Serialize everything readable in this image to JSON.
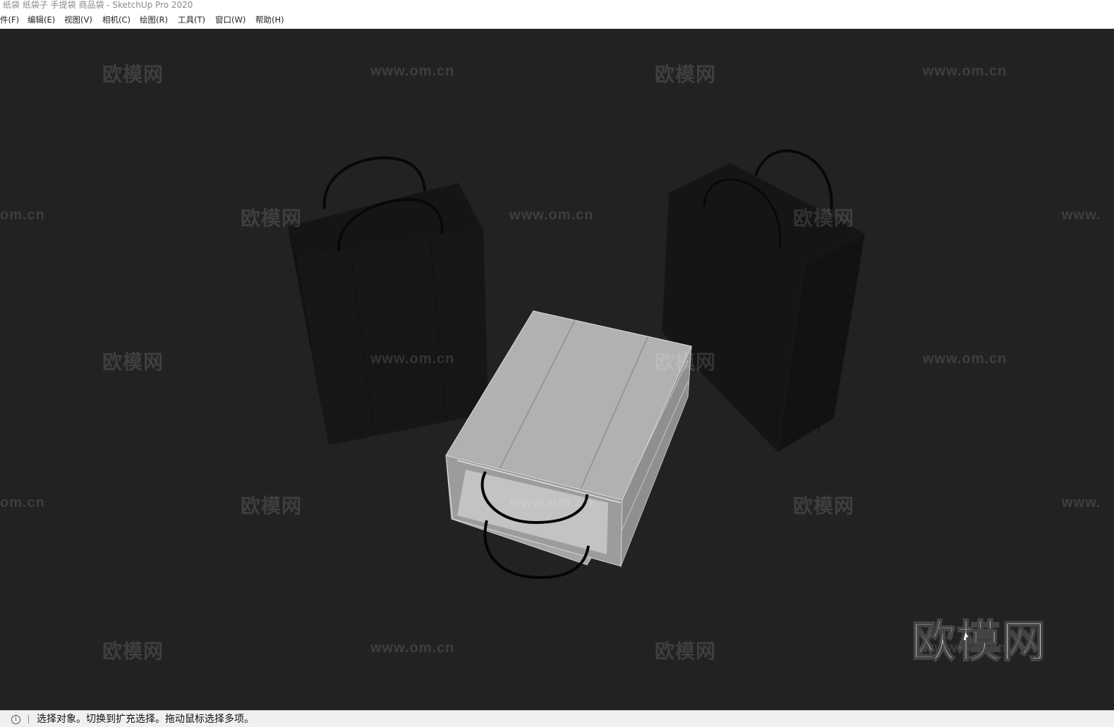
{
  "window": {
    "title": "纸袋 纸袋子 手提袋 商品袋 - SketchUp Pro 2020"
  },
  "menubar": {
    "items": [
      {
        "label": "件(F)"
      },
      {
        "label": "编辑(E)"
      },
      {
        "label": "视图(V)"
      },
      {
        "label": "相机(C)"
      },
      {
        "label": "绘图(R)"
      },
      {
        "label": "工具(T)"
      },
      {
        "label": "窗口(W)"
      },
      {
        "label": "帮助(H)"
      }
    ]
  },
  "viewport": {
    "background_color": "#222222",
    "watermark_cn": "欧模网",
    "watermark_url": "www.om.cn",
    "watermark_url_partial_left": "om.cn",
    "watermark_url_partial_right": "www.",
    "logo_text": "欧模网",
    "objects": [
      {
        "name": "black-paper-bag-left",
        "color": "#141414"
      },
      {
        "name": "black-paper-bag-right",
        "color": "#141414"
      },
      {
        "name": "white-paper-bag-lying",
        "color": "#a9a9a9"
      }
    ]
  },
  "statusbar": {
    "icon": "info-icon",
    "message": "选择对象。切换到扩充选择。拖动鼠标选择多项。"
  }
}
